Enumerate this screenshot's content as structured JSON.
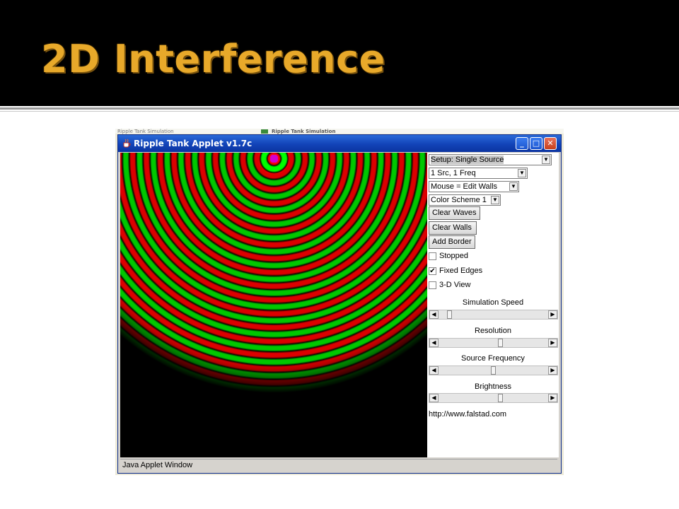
{
  "slide": {
    "title": "2D Interference",
    "title_color": "#e8a92a",
    "header_background": "#000000"
  },
  "window": {
    "title": "Ripple Tank Applet v1.7c",
    "status": "Java Applet Window",
    "minimize_glyph": "_",
    "maximize_glyph": "□",
    "close_glyph": "✕"
  },
  "controls": {
    "setup": "Setup: Single Source",
    "sources": "1 Src, 1 Freq",
    "mouse_mode": "Mouse = Edit Walls",
    "color_scheme": "Color Scheme 1",
    "clear_waves": "Clear Waves",
    "clear_walls": "Clear Walls",
    "add_border": "Add Border",
    "stopped": {
      "label": "Stopped",
      "checked": false
    },
    "fixed_edges": {
      "label": "Fixed Edges",
      "checked": true
    },
    "three_d_view": {
      "label": "3-D View",
      "checked": false
    },
    "sliders": [
      {
        "label": "Simulation Speed",
        "value": 0.08
      },
      {
        "label": "Resolution",
        "value": 0.57
      },
      {
        "label": "Source Frequency",
        "value": 0.5
      },
      {
        "label": "Brightness",
        "value": 0.57
      }
    ],
    "url": "http://www.falstad.com"
  },
  "simulation": {
    "wave_colors": [
      "#ff0000",
      "#00ff00"
    ],
    "source_color": "#d000d0"
  },
  "background_fragments": [
    "Ripple Tank Simulation",
    "Ripple Tank Simulation"
  ]
}
